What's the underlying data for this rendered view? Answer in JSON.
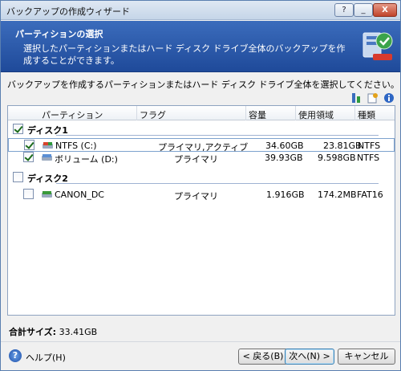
{
  "window": {
    "title": "バックアップの作成ウィザード",
    "controls": {
      "help": "?",
      "minimize": "_",
      "close": "X"
    }
  },
  "header": {
    "title": "パーティションの選択",
    "description": "選択したパーティションまたはハード ディスク ドライブ全体のバックアップを作成することができます。"
  },
  "instruction": "バックアップを作成するパーティションまたはハード ディスク ドライブ全体を選択してください。",
  "columns": [
    "パーティション",
    "フラグ",
    "容量",
    "使用領域",
    "種類"
  ],
  "disks": [
    {
      "name": "ディスク1",
      "checked": true,
      "partitions": [
        {
          "name": "NTFS (C:)",
          "flags": "プライマリ,アクティブ",
          "capacity": "34.60GB",
          "used": "23.81GB",
          "type": "NTFS",
          "checked": true,
          "selected": true
        },
        {
          "name": "ボリューム (D:)",
          "flags": "プライマリ",
          "capacity": "39.93GB",
          "used": "9.598GB",
          "type": "NTFS",
          "checked": true,
          "selected": false
        }
      ]
    },
    {
      "name": "ディスク2",
      "checked": false,
      "partitions": [
        {
          "name": "CANON_DC",
          "flags": "プライマリ",
          "capacity": "1.916GB",
          "used": "174.2MB",
          "type": "FAT16",
          "checked": false,
          "selected": false
        }
      ]
    }
  ],
  "total": {
    "label": "合計サイズ:",
    "value": "33.41GB"
  },
  "footer": {
    "help": "ヘルプ(H)",
    "back": "< 戻る(B)",
    "next": "次へ(N) >",
    "cancel": "キャンセル"
  },
  "colors": {
    "header_bg": "#2a58a8",
    "accent": "#3c7fb1"
  }
}
